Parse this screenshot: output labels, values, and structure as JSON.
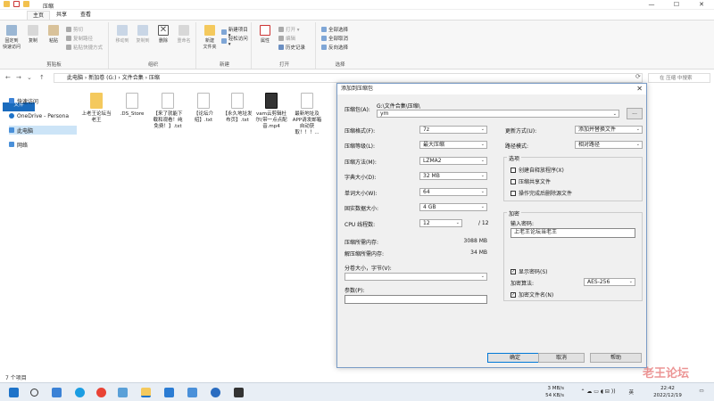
{
  "window": {
    "title": "压缩",
    "minimize": "—",
    "maximize": "☐",
    "close": "✕"
  },
  "tabs": {
    "file": "文件",
    "home": "主页",
    "share": "共享",
    "view": "查看"
  },
  "ribbon": {
    "pin": "固定到\n快速访问",
    "copy": "复制",
    "paste": "粘贴",
    "cut": "剪切",
    "copy_path": "复制路径",
    "paste_shortcut": "粘贴快捷方式",
    "clipboard": "剪贴板",
    "move_to": "移动到",
    "copy_to": "复制到",
    "delete": "删除",
    "rename": "重命名",
    "organize": "组织",
    "new_folder": "新建\n文件夹",
    "new_item": "新建项目 ▾",
    "easy_access": "轻松访问 ▾",
    "new_group": "新建",
    "properties": "属性",
    "open": "打开 ▾",
    "edit": "编辑",
    "history": "历史记录",
    "open_group": "打开",
    "select_all": "全部选择",
    "select_none": "全部取消",
    "invert": "反向选择",
    "select_group": "选择"
  },
  "address": {
    "path": "此电脑  ›  新加卷 (G:)  ›  文件合集  ›  压缩",
    "search_placeholder": "在 压缩 中搜索"
  },
  "nav": {
    "quick": "快速访问",
    "onedrive": "OneDrive - Persona",
    "pc": "此电脑",
    "network": "网络"
  },
  "files": [
    {
      "name": "上老王论坛当老王",
      "type": "folder"
    },
    {
      "name": ".DS_Store",
      "type": "doc"
    },
    {
      "name": "【来了就能下载和观看！纯免费！】.txt",
      "type": "doc"
    },
    {
      "name": "【论坛介绍】.txt",
      "type": "doc"
    },
    {
      "name": "【永久地址发布页】.txt",
      "type": "doc"
    },
    {
      "name": "vam云剪辑杜尔(带一点点配音.mp4",
      "type": "video"
    },
    {
      "name": "最新地址及APP请发邮箱自动获取！！！...",
      "type": "doc"
    }
  ],
  "status": "7 个项目",
  "dialog": {
    "title": "添加到压缩包",
    "close": "✕",
    "archive_label": "压缩包(A):",
    "archive_path": "G:\\文件合集\\压缩\\",
    "archive_name": "ym",
    "browse": "...",
    "format_label": "压缩格式(F):",
    "format": "7z",
    "level_label": "压缩等级(L):",
    "level": "最大压缩",
    "method_label": "压缩方法(M):",
    "method": "LZMA2",
    "dict_label": "字典大小(D):",
    "dict": "32 MB",
    "word_label": "单词大小(W):",
    "word": "64",
    "solid_label": "固实数据大小:",
    "solid": "4 GB",
    "cpu_label": "CPU 线程数:",
    "cpu": "12",
    "cpu_total": "/ 12",
    "mem_comp_label": "压缩所需内存:",
    "mem_comp": "3088 MB",
    "mem_decomp_label": "解压缩所需内存:",
    "mem_decomp": "34 MB",
    "split_label": "分卷大小，字节(V):",
    "params_label": "参数(P):",
    "update_label": "更新方式(U):",
    "update": "添加并替换文件",
    "pathmode_label": "路径模式:",
    "pathmode": "相对路径",
    "options_label": "选项",
    "opt_sfx": "创建自释放程序(X)",
    "opt_shared": "压缩共享文件",
    "opt_delete": "操作完成后删除源文件",
    "encrypt_label": "加密",
    "password_label": "输入密码:",
    "password": "上老王论坛当老王",
    "show_password": "显示密码(S)",
    "enc_method_label": "加密算法:",
    "enc_method": "AES-256",
    "encrypt_names": "加密文件名(N)",
    "ok": "确定",
    "cancel": "取消",
    "help": "帮助"
  },
  "taskbar": {
    "net_up": "3 MB/s",
    "net_down": "54 KB/s",
    "lang": "英",
    "time": "22:42",
    "date": "2022/12/19"
  },
  "watermark": "老王论坛",
  "colors": {
    "accent": "#1a6bbd",
    "folder": "#f4c95d"
  }
}
